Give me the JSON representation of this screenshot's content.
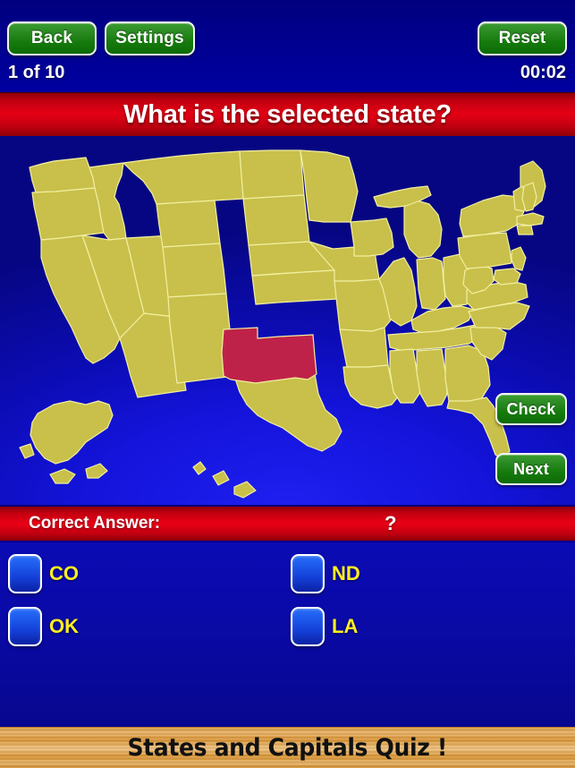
{
  "topbar": {
    "back_label": "Back",
    "settings_label": "Settings",
    "reset_label": "Reset",
    "progress": "1 of 10",
    "timer": "00:02"
  },
  "question": {
    "text": "What is the selected state?"
  },
  "map": {
    "check_label": "Check",
    "next_label": "Next",
    "selected_state": "Oklahoma",
    "state_fill": "#c8c04a",
    "state_border": "#f2eea0",
    "selected_fill": "#bf2249",
    "ocean_color": "#1414dc"
  },
  "answer": {
    "label": "Correct Answer:",
    "value": "?"
  },
  "options": [
    {
      "label": "CO"
    },
    {
      "label": "ND"
    },
    {
      "label": "OK"
    },
    {
      "label": "LA"
    }
  ],
  "footer": {
    "title": "States and Capitals Quiz !"
  }
}
